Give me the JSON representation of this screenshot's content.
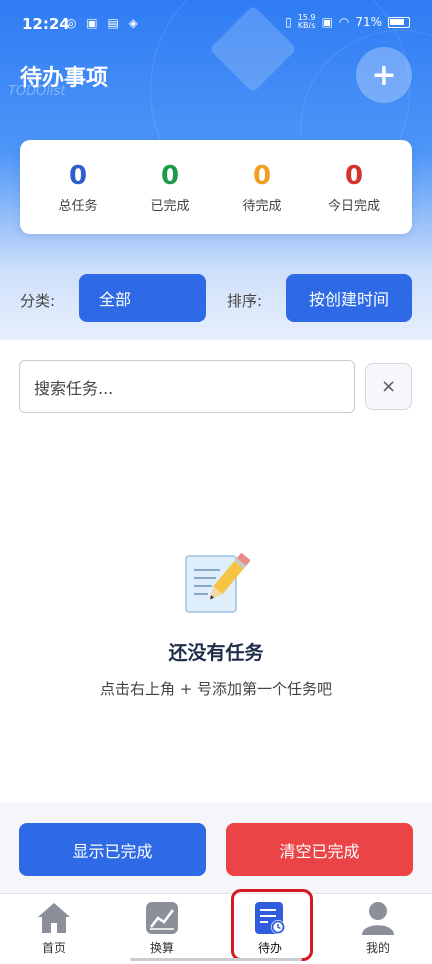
{
  "statusbar": {
    "time": "12:24",
    "apps": "◎ ▣ ▤ ◈",
    "netspeed_value": "15.9",
    "netspeed_unit": "KB/s",
    "battery": "71%"
  },
  "header": {
    "title": "待办事项",
    "subtitle": "TODOlist",
    "add_label": "+"
  },
  "stats": [
    {
      "value": "0",
      "label": "总任务",
      "color": "#2f5fcf"
    },
    {
      "value": "0",
      "label": "已完成",
      "color": "#1f9a4b"
    },
    {
      "value": "0",
      "label": "待完成",
      "color": "#f0a020"
    },
    {
      "value": "0",
      "label": "今日完成",
      "color": "#d3342c"
    }
  ],
  "filters": {
    "category_label": "分类:",
    "category_value": "全部",
    "sort_label": "排序:",
    "sort_value": "按创建时间"
  },
  "search": {
    "placeholder": "搜索任务...",
    "clear_label": "×"
  },
  "empty": {
    "title": "还没有任务",
    "hint": "点击右上角 + 号添加第一个任务吧"
  },
  "actions": {
    "show_completed": "显示已完成",
    "clear_completed": "清空已完成"
  },
  "nav": [
    {
      "label": "首页",
      "icon": "home-icon"
    },
    {
      "label": "换算",
      "icon": "chart-icon"
    },
    {
      "label": "待办",
      "icon": "todo-icon",
      "active": true
    },
    {
      "label": "我的",
      "icon": "user-icon"
    }
  ],
  "colors": {
    "primary": "#2f6ae6",
    "danger": "#ea4446"
  }
}
